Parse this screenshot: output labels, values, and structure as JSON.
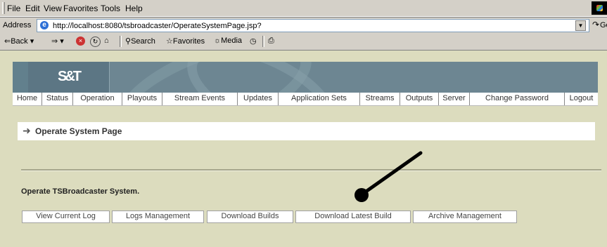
{
  "browser": {
    "menu": [
      "File",
      "Edit",
      "View",
      "Favorites",
      "Tools",
      "Help"
    ],
    "address_label": "Address",
    "url": "http://localhost:8080/tsbroadcaster/OperateSystemPage.jsp?",
    "go_label": "Go",
    "toolbar": {
      "back": "Back",
      "search": "Search",
      "favorites": "Favorites",
      "media": "Media"
    }
  },
  "app": {
    "logo": "S&T",
    "nav": [
      "Home",
      "Status",
      "Operation",
      "Playouts",
      "Stream Events",
      "Updates",
      "Application Sets",
      "Streams",
      "Outputs",
      "Server",
      "Change Password",
      "Logout"
    ],
    "page_title": "Operate System Page",
    "section_label": "Operate TSBroadcaster System.",
    "buttons": [
      "View Current Log",
      "Logs Management",
      "Download Builds",
      "Download Latest Build",
      "Archive Management"
    ]
  }
}
